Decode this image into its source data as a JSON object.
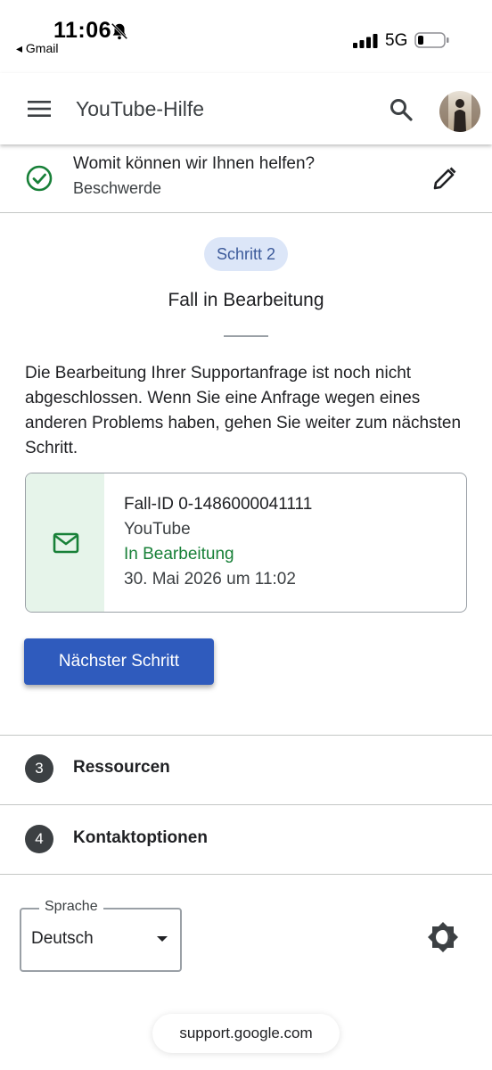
{
  "status_bar": {
    "time": "11:06",
    "back_app": "◂ Gmail",
    "network": "5G"
  },
  "header": {
    "title": "YouTube-Hilfe"
  },
  "step1": {
    "question": "Womit können wir Ihnen helfen?",
    "answer": "Beschwerde"
  },
  "step2": {
    "chip": "Schritt 2",
    "title": "Fall in Bearbeitung",
    "description": "Die Bearbeitung Ihrer Supportanfrage ist noch nicht abgeschlossen. Wenn Sie eine Anfrage wegen eines anderen Problems haben, gehen Sie weiter zum nächsten Schritt.",
    "case": {
      "id": "Fall-ID 0-1486000041111",
      "product": "YouTube",
      "status": "In Bearbeitung",
      "date": "30. Mai 2026 um 11:02"
    },
    "next_button": "Nächster Schritt"
  },
  "steps_rest": [
    {
      "number": "3",
      "label": "Ressourcen"
    },
    {
      "number": "4",
      "label": "Kontaktoptionen"
    }
  ],
  "footer": {
    "language_label": "Sprache",
    "language_value": "Deutsch",
    "url": "support.google.com"
  },
  "colors": {
    "primary_button": "#2f5bbd",
    "status_green": "#188038",
    "chip_bg": "#dce6f8",
    "card_accent_bg": "#e6f4ea"
  },
  "icons": [
    "bell-off-icon",
    "signal-icon",
    "battery-icon",
    "menu-icon",
    "search-icon",
    "check-circle-icon",
    "pencil-icon",
    "mail-icon",
    "dropdown-caret-icon",
    "theme-toggle-icon"
  ]
}
